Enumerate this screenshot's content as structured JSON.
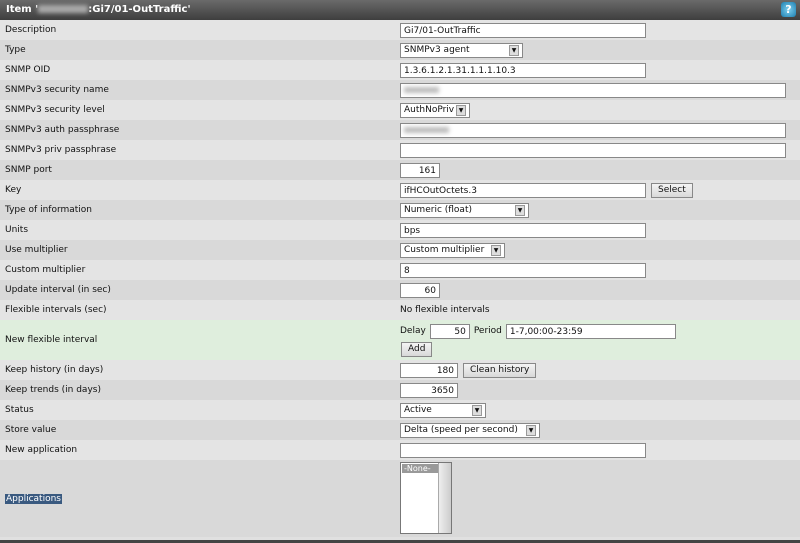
{
  "header": {
    "title_prefix": "Item '",
    "title_suffix": ":Gi7/01-OutTraffic'",
    "help_icon": "?"
  },
  "rows": {
    "description": {
      "label": "Description",
      "value": "Gi7/01-OutTraffic"
    },
    "type": {
      "label": "Type",
      "value": "SNMPv3 agent"
    },
    "oid": {
      "label": "SNMP OID",
      "value": "1.3.6.1.2.1.31.1.1.1.10.3"
    },
    "sec_name": {
      "label": "SNMPv3 security name"
    },
    "sec_level": {
      "label": "SNMPv3 security level",
      "value": "AuthNoPriv"
    },
    "auth": {
      "label": "SNMPv3 auth passphrase"
    },
    "priv": {
      "label": "SNMPv3 priv passphrase",
      "value": ""
    },
    "port": {
      "label": "SNMP port",
      "value": "161"
    },
    "key": {
      "label": "Key",
      "value": "ifHCOutOctets.3",
      "button": "Select"
    },
    "type_info": {
      "label": "Type of information",
      "value": "Numeric (float)"
    },
    "units": {
      "label": "Units",
      "value": "bps"
    },
    "use_mult": {
      "label": "Use multiplier",
      "value": "Custom multiplier"
    },
    "custom_mult": {
      "label": "Custom multiplier",
      "value": "8"
    },
    "update": {
      "label": "Update interval (in sec)",
      "value": "60"
    },
    "flexible": {
      "label": "Flexible intervals (sec)",
      "value": "No flexible intervals"
    },
    "new_flex": {
      "label": "New flexible interval",
      "delay_label": "Delay",
      "delay": "50",
      "period_label": "Period",
      "period": "1-7,00:00-23:59",
      "button": "Add"
    },
    "history": {
      "label": "Keep history (in days)",
      "value": "180",
      "button": "Clean history"
    },
    "trends": {
      "label": "Keep trends (in days)",
      "value": "3650"
    },
    "status": {
      "label": "Status",
      "value": "Active"
    },
    "store": {
      "label": "Store value",
      "value": "Delta (speed per second)"
    },
    "new_app": {
      "label": "New application",
      "value": ""
    },
    "apps": {
      "label": "Applications",
      "options": [
        "-None-"
      ]
    }
  }
}
